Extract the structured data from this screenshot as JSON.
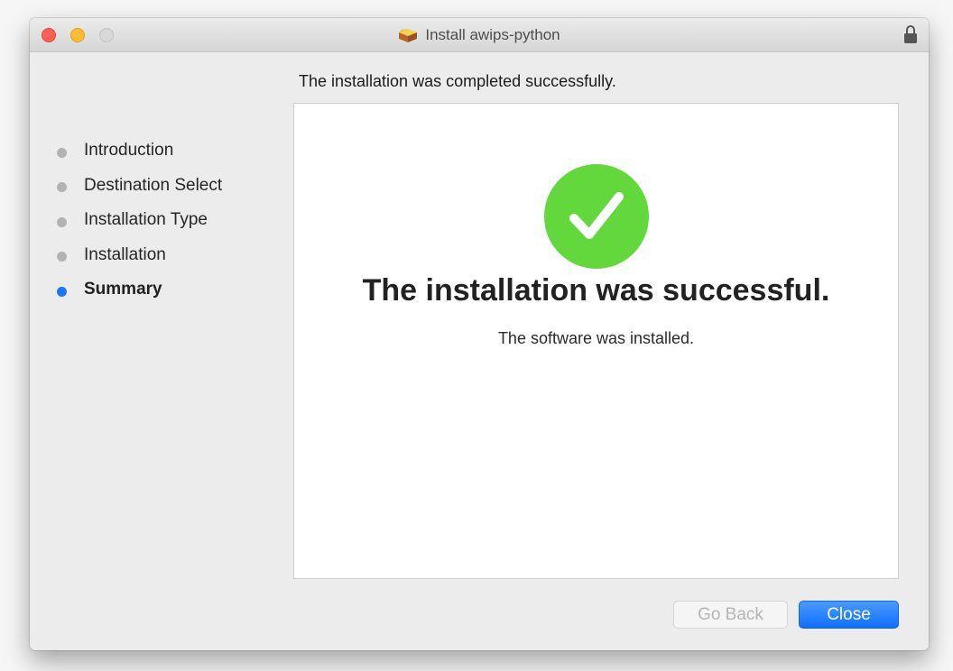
{
  "window": {
    "title": "Install awips-python",
    "title_icon": "package-icon",
    "lock_icon": "lock-icon",
    "traffic_lights": [
      "close",
      "minimize",
      "zoom"
    ]
  },
  "sidebar": {
    "steps": [
      {
        "label": "Introduction",
        "active": false
      },
      {
        "label": "Destination Select",
        "active": false
      },
      {
        "label": "Installation Type",
        "active": false
      },
      {
        "label": "Installation",
        "active": false
      },
      {
        "label": "Summary",
        "active": true
      }
    ]
  },
  "main": {
    "header": "The installation was completed successfully.",
    "status_icon": "success-check-icon",
    "title": "The installation was successful.",
    "subtitle": "The software was installed."
  },
  "buttons": {
    "go_back": {
      "label": "Go Back",
      "enabled": false
    },
    "close": {
      "label": "Close",
      "enabled": true
    }
  },
  "colors": {
    "accent": "#1a78f2",
    "success": "#62d83d",
    "close_red": "#fe5f57",
    "minimize_yellow": "#febc2e"
  }
}
